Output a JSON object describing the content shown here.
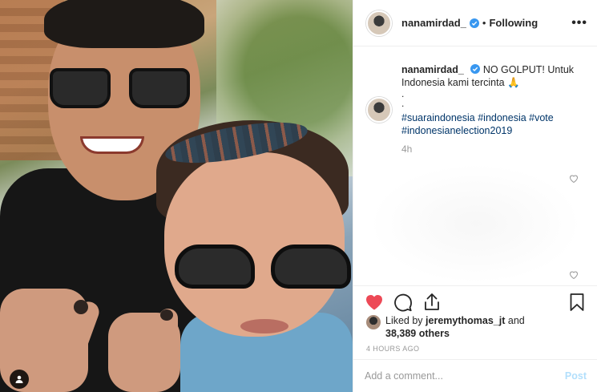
{
  "header": {
    "username": "nanamirdad_",
    "separator": "•",
    "follow_status": "Following",
    "more": "•••"
  },
  "caption": {
    "username": "nanamirdad_",
    "text": "NO GOLPUT! Untuk Indonesia kami tercinta 🙏",
    "dots": ".\n.",
    "hashtags": "#suaraindonesia #indonesia #vote #indonesianelection2019",
    "time": "4h"
  },
  "likes": {
    "prefix": "Liked by ",
    "liker": "jeremythomas_jt",
    "mid": " and ",
    "count": "38,389 others"
  },
  "timestamp": "4 HOURS AGO",
  "comment_box": {
    "placeholder": "Add a comment...",
    "post_label": "Post"
  },
  "colors": {
    "liked_heart": "#ed4956",
    "verified_badge": "#3897f0",
    "hashtag": "#003569",
    "post_disabled": "#b2dffc"
  },
  "icons": {
    "like": "heart-filled-icon",
    "comment": "comment-bubble-icon",
    "share": "share-icon",
    "save": "bookmark-icon",
    "user_tag": "user-tag-icon",
    "verified": "verified-badge-icon"
  }
}
